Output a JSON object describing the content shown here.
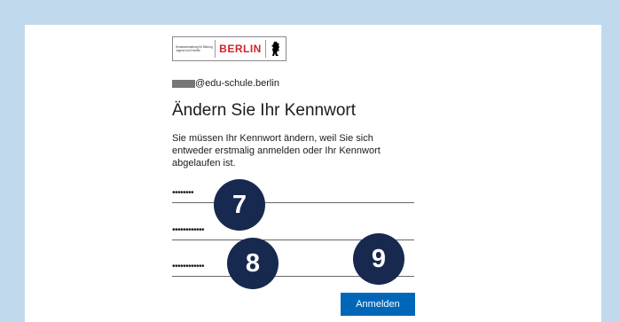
{
  "logo": {
    "dept_text": "Senatsverwaltung für Bildung, Jugend und Familie",
    "brand": "BERLIN",
    "emblem_icon": "berlin-bear-icon"
  },
  "account": {
    "email_suffix": "@edu-schule.berlin"
  },
  "title": "Ändern Sie Ihr Kennwort",
  "description": "Sie müssen Ihr Kennwort ändern, weil Sie sich entweder erstmalig anmelden oder Ihr Kennwort abgelaufen ist.",
  "fields": {
    "current_password": "••••••••",
    "new_password": "••••••••••••",
    "confirm_password": "••••••••••••"
  },
  "badges": {
    "b7": "7",
    "b8": "8",
    "b9": "9"
  },
  "submit_label": "Anmelden",
  "colors": {
    "background": "#c1d9ec",
    "badge": "#17294f",
    "button": "#0067b8",
    "brand_red": "#d2232a"
  }
}
